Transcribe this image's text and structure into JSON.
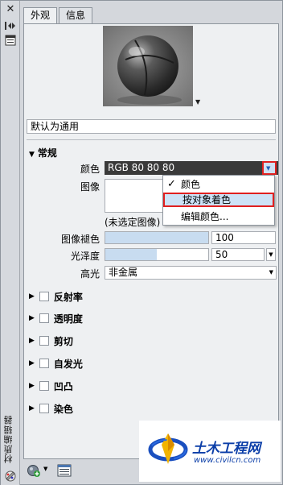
{
  "palette": {
    "side_title": "材质编辑器",
    "close_glyph": "✕"
  },
  "tabs": [
    {
      "label": "外观"
    },
    {
      "label": "信息"
    }
  ],
  "material": {
    "name": "默认为通用",
    "preview_arrow": "▼"
  },
  "generic": {
    "header": "常规",
    "color_label": "颜色",
    "color_value": "RGB 80 80 80",
    "image_label": "图像",
    "image_caption": "(未选定图像)",
    "image_fade_label": "图像褪色",
    "image_fade_value": "100",
    "image_fade_level": 1.0,
    "glossiness_label": "光泽度",
    "glossiness_value": "50",
    "glossiness_level": 0.5,
    "highlight_label": "高光",
    "highlight_value": "非金属"
  },
  "color_menu": {
    "items": [
      {
        "label": "颜色",
        "checked": true
      },
      {
        "label": "按对象着色",
        "highlighted": true
      },
      {
        "label": "编辑颜色..."
      }
    ]
  },
  "groups": [
    {
      "label": "反射率"
    },
    {
      "label": "透明度"
    },
    {
      "label": "剪切"
    },
    {
      "label": "自发光"
    },
    {
      "label": "凹凸"
    },
    {
      "label": "染色"
    }
  ],
  "watermark": {
    "title": "土木工程网",
    "url": "www.civilcn.com"
  },
  "colors": {
    "accent_highlight": "#e02020",
    "selection": "#cde3f7",
    "watermark_blue": "#0b3ea8"
  }
}
